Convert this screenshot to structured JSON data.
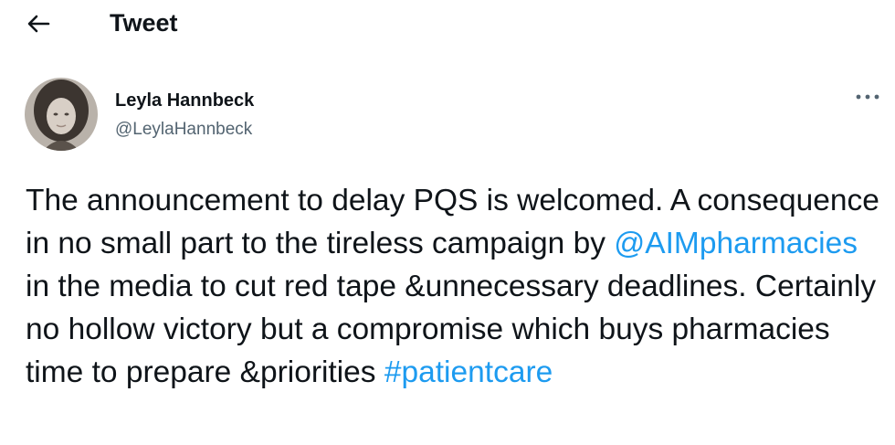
{
  "header": {
    "title": "Tweet",
    "back_icon": "arrow-left-icon"
  },
  "author": {
    "display_name": "Leyla Hannbeck",
    "handle": "@LeylaHannbeck",
    "avatar_icon": "avatar-photo",
    "more_icon": "more-horizontal-icon"
  },
  "tweet": {
    "text_part1": "The announcement to delay PQS is welcomed. A consequence in no small part to the tireless campaign by ",
    "mention": "@AIMpharmacies",
    "text_part2": " in the media to cut red tape &unnecessary deadlines. Certainly no hollow victory but a compromise which buys pharmacies time to prepare &priorities ",
    "hashtag": "#patientcare"
  },
  "colors": {
    "text": "#0f1419",
    "secondary": "#536471",
    "link": "#1d9bf0",
    "background": "#ffffff"
  }
}
